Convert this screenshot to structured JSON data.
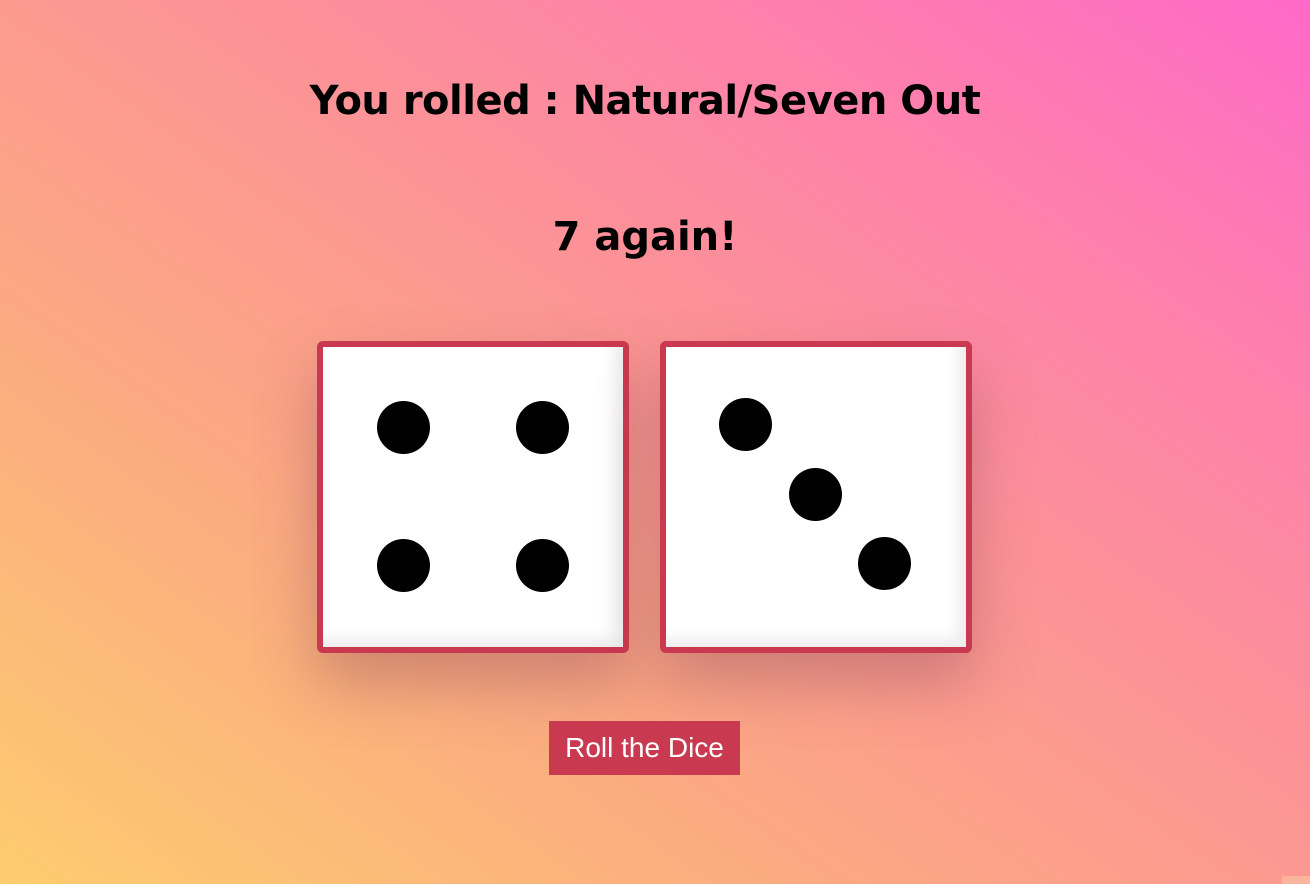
{
  "game": {
    "result_label": "You rolled : Natural/Seven Out",
    "message": "7 again!",
    "dice": [
      {
        "value": 4,
        "pips": 4
      },
      {
        "value": 3,
        "pips": 3
      }
    ],
    "roll_button_label": "Roll the Dice"
  },
  "colors": {
    "accent": "#c9394f",
    "pip": "#000000",
    "die_face": "#ffffff"
  }
}
